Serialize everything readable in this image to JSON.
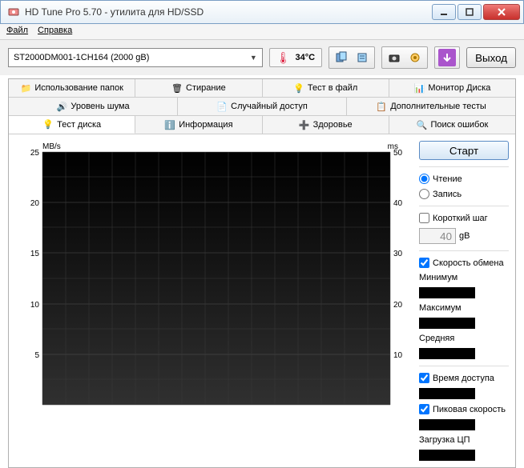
{
  "window": {
    "title": "HD Tune Pro 5.70 - утилита для HD/SSD"
  },
  "menu": {
    "file": "Файл",
    "help": "Справка"
  },
  "toolbar": {
    "drive_label": "ST2000DM001-1CH164 (2000 gB)",
    "temperature": "34°C",
    "exit_label": "Выход"
  },
  "tabs_row1": {
    "folder_usage": "Использование папок",
    "erase": "Стирание",
    "file_test": "Тест в файл",
    "disk_monitor": "Монитор Диска"
  },
  "tabs_row2": {
    "noise": "Уровень шума",
    "random": "Случайный доступ",
    "extra": "Дополнительные тесты"
  },
  "tabs_row3": {
    "benchmark": "Тест диска",
    "info": "Информация",
    "health": "Здоровье",
    "errors": "Поиск ошибок"
  },
  "side": {
    "start": "Старт",
    "read": "Чтение",
    "write": "Запись",
    "short_stroke": "Короткий шаг",
    "step_value": "40",
    "step_unit": "gB",
    "transfer_rate": "Скорость обмена",
    "minimum": "Минимум",
    "maximum": "Максимум",
    "average": "Средняя",
    "access_time": "Время доступа",
    "burst_rate": "Пиковая скорость",
    "cpu_usage": "Загрузка ЦП"
  },
  "chart_data": {
    "type": "line",
    "title": "",
    "xlabel": "",
    "left_axis": {
      "label": "MB/s",
      "ticks": [
        5,
        10,
        15,
        20,
        25
      ],
      "range": [
        0,
        25
      ]
    },
    "right_axis": {
      "label": "ms",
      "ticks": [
        10,
        20,
        30,
        40,
        50
      ],
      "range": [
        0,
        50
      ]
    },
    "series": [
      {
        "name": "transfer",
        "values": []
      },
      {
        "name": "access",
        "values": []
      }
    ]
  }
}
